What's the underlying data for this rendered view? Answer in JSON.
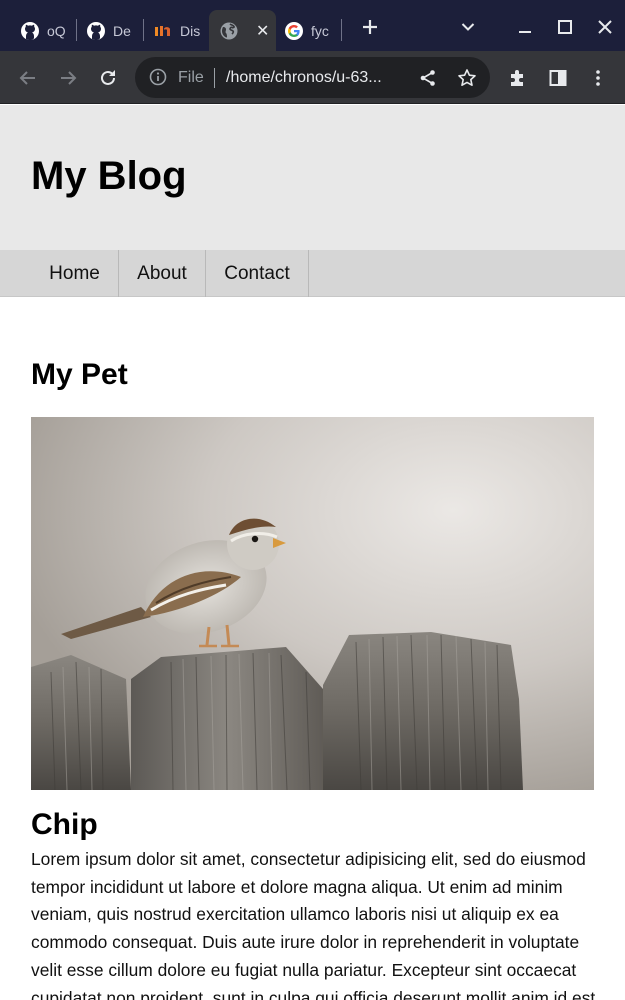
{
  "browser": {
    "tabs": [
      {
        "label": "oQ",
        "icon": "github-icon"
      },
      {
        "label": "De",
        "icon": "github-icon"
      },
      {
        "label": "Dis",
        "icon": "medium-icon"
      },
      {
        "label": "",
        "icon": "globe-icon",
        "active": true
      },
      {
        "label": "fyc",
        "icon": "google-icon"
      }
    ],
    "address": {
      "scheme": "File",
      "url": "/home/chronos/u-63..."
    }
  },
  "site": {
    "title": "My Blog",
    "nav": [
      "Home",
      "About",
      "Contact"
    ]
  },
  "post": {
    "title": "My Pet",
    "pet_name": "Chip",
    "body": "Lorem ipsum dolor sit amet, consectetur adipisicing elit, sed do eiusmod tempor incididunt ut labore et dolore magna aliqua. Ut enim ad minim veniam, quis nostrud exercitation ullamco laboris nisi ut aliquip ex ea commodo consequat. Duis aute irure dolor in reprehenderit in voluptate velit esse cillum dolore eu fugiat nulla pariatur. Excepteur sint occaecat cupidatat non proident, sunt in culpa qui officia deserunt mollit anim id est laborum."
  }
}
